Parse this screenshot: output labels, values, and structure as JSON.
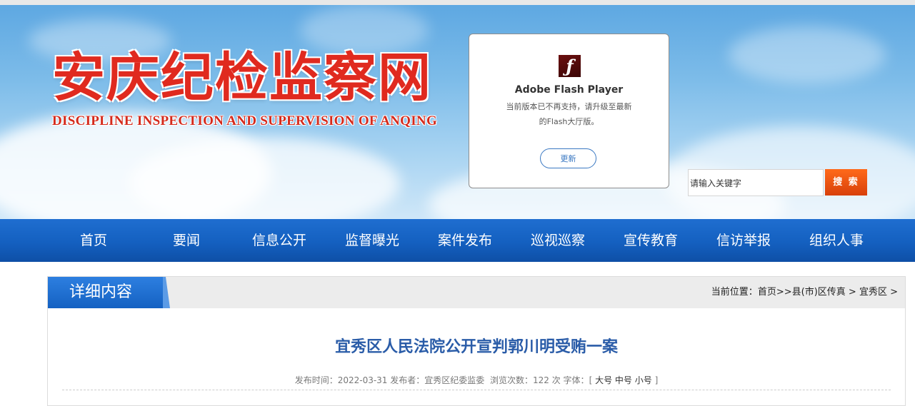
{
  "header": {
    "title": "安庆纪检监察网",
    "subtitle": "DISCIPLINE INSPECTION AND SUPERVISION OF ANQING"
  },
  "flash": {
    "icon": "flash-player-icon",
    "name": "Adobe Flash Player",
    "message_line1": "当前版本已不再支持，请升级至最新",
    "message_line2": "的Flash大厅版。",
    "update_label": "更新"
  },
  "search": {
    "value": "请输入关键字",
    "button_label": "搜 索"
  },
  "nav": {
    "items": [
      "首页",
      "要闻",
      "信息公开",
      "监督曝光",
      "案件发布",
      "巡视巡察",
      "宣传教育",
      "信访举报",
      "组织人事"
    ]
  },
  "panel": {
    "tab_label": "详细内容",
    "breadcrumb": {
      "prefix": "当前位置：",
      "home": "首页",
      "sep1": ">>",
      "level1": "县(市)区传真",
      "sep2": " > ",
      "level2": "宜秀区",
      "sep3": " >"
    }
  },
  "article": {
    "title": "宜秀区人民法院公开宣判郭川明受贿一案",
    "meta": {
      "publish_label": "发布时间：",
      "publish_date": "2022-03-31",
      "publisher_label": "发布者：",
      "publisher": "宜秀区纪委监委",
      "views_label": "浏览次数：",
      "views": "122",
      "views_unit": "次",
      "font_label": "字体：",
      "bracket_open": "[",
      "size_large": "大号",
      "size_medium": "中号",
      "size_small": "小号",
      "bracket_close": "]"
    }
  },
  "colors": {
    "nav_bg": "#1460c0",
    "title_red": "#e02a1f",
    "article_title": "#2a5ca8",
    "search_button": "#e8531a"
  }
}
